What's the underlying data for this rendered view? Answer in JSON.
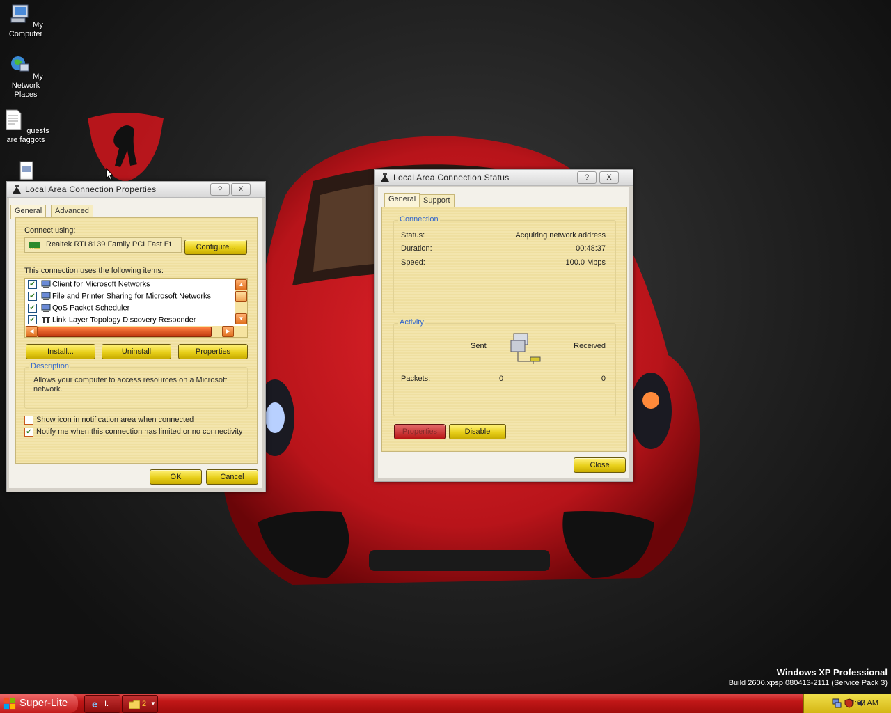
{
  "desktop": {
    "icons": [
      {
        "label": "My Computer"
      },
      {
        "label": "My Network Places"
      },
      {
        "label": "guests are faggots"
      },
      {
        "label": ""
      }
    ],
    "watermark": {
      "line1": "Windows XP Professional",
      "line2": "Build 2600.xpsp.080413-2111 (Service Pack 3)"
    }
  },
  "props_window": {
    "title": "Local Area Connection Properties",
    "help_label": "?",
    "close_label": "X",
    "tabs": [
      {
        "label": "General"
      },
      {
        "label": "Advanced"
      }
    ],
    "connect_using_label": "Connect using:",
    "adapter_name": "Realtek RTL8139 Family PCI Fast Et",
    "configure_label": "Configure...",
    "items_label": "This connection uses the following items:",
    "items": [
      {
        "label": "Client for Microsoft Networks",
        "checked": true
      },
      {
        "label": "File and Printer Sharing for Microsoft Networks",
        "checked": true
      },
      {
        "label": "QoS Packet Scheduler",
        "checked": true
      },
      {
        "label": "Link-Layer Topology Discovery Responder",
        "checked": true
      }
    ],
    "install_label": "Install...",
    "uninstall_label": "Uninstall",
    "properties_label": "Properties",
    "description_title": "Description",
    "description_text": "Allows your computer to access resources on a Microsoft network.",
    "show_icon_label": "Show icon in notification area when connected",
    "show_icon_checked": false,
    "notify_label": "Notify me when this connection has limited or no connectivity",
    "notify_checked": true,
    "ok_label": "OK",
    "cancel_label": "Cancel"
  },
  "status_window": {
    "title": "Local Area Connection Status",
    "help_label": "?",
    "close_label": "X",
    "tabs": [
      {
        "label": "General"
      },
      {
        "label": "Support"
      }
    ],
    "connection_title": "Connection",
    "status_label": "Status:",
    "status_value": "Acquiring network address",
    "duration_label": "Duration:",
    "duration_value": "00:48:37",
    "speed_label": "Speed:",
    "speed_value": "100.0 Mbps",
    "activity_title": "Activity",
    "sent_label": "Sent",
    "received_label": "Received",
    "packets_label": "Packets:",
    "packets_sent": "0",
    "packets_received": "0",
    "properties_label": "Properties",
    "disable_label": "Disable",
    "close_button_label": "Close"
  },
  "taskbar": {
    "start_label": "Super-Lite",
    "task1_label": "I.",
    "task2_label": "2",
    "clock": "1:07 AM"
  },
  "colors": {
    "taskbar": "#c11717",
    "tray": "#d4b614",
    "button_yellow": "#e8cf1a",
    "group_title": "#3366cc"
  }
}
